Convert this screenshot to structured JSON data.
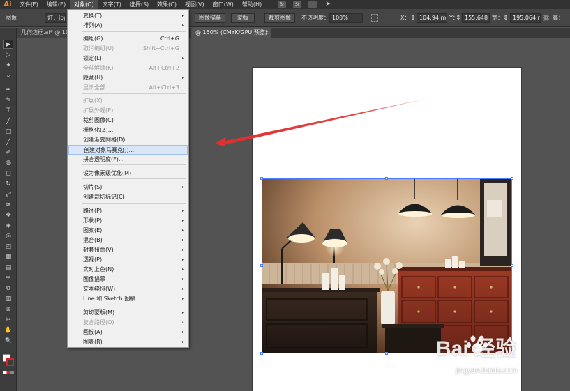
{
  "app": {
    "logo": "Ai"
  },
  "menubar": {
    "items": [
      "文件(F)",
      "编辑(E)",
      "对象(O)",
      "文字(T)",
      "选择(S)",
      "效果(C)",
      "视图(V)",
      "窗口(W)",
      "帮助(H)"
    ],
    "icons": [
      "Br",
      "St"
    ]
  },
  "controlbar": {
    "selection_type": "图像",
    "filename": "灯．jpg",
    "resolution_label": "PPI: 72",
    "trace_button": "图像描摹",
    "mask_button": "蒙版",
    "crop_button": "裁剪图像",
    "opacity_label": "不透明度：",
    "opacity_value": "100%",
    "x_label": "X：",
    "x_value": "104.94 mm",
    "y_label": "Y：",
    "y_value": "155.648 m",
    "w_label": "宽：",
    "w_value": "195.064 m",
    "h_label": "高："
  },
  "tabs": {
    "tab1": "几何边框.ai* @ 10",
    "tab2": "@ 150% (CMYK/GPU 预览)",
    "close": "×"
  },
  "tools": [
    "▶",
    "▷",
    "✦",
    "⌕",
    "✒",
    "✎",
    "T",
    "╱",
    "□",
    "╱",
    "✐",
    "◍",
    "◻",
    "↻",
    "⤢",
    "≋",
    "✥",
    "◈",
    "◎",
    "◰",
    "▦",
    "▤",
    "✑",
    "⧉",
    "▥",
    "⧈",
    "✂",
    "✋",
    "🔍"
  ],
  "object_menu": {
    "items": [
      {
        "label": "变换(T)",
        "shortcut": "",
        "submenu": true,
        "disabled": false
      },
      {
        "label": "排列(A)",
        "shortcut": "",
        "submenu": true,
        "disabled": false
      },
      {
        "label": "编组(G)",
        "shortcut": "Ctrl+G",
        "submenu": false,
        "disabled": false
      },
      {
        "label": "取消编组(U)",
        "shortcut": "Shift+Ctrl+G",
        "submenu": false,
        "disabled": true
      },
      {
        "label": "锁定(L)",
        "shortcut": "",
        "submenu": true,
        "disabled": false
      },
      {
        "label": "全部解锁(K)",
        "shortcut": "Alt+Ctrl+2",
        "submenu": false,
        "disabled": true
      },
      {
        "label": "隐藏(H)",
        "shortcut": "",
        "submenu": true,
        "disabled": false
      },
      {
        "label": "显示全部",
        "shortcut": "Alt+Ctrl+3",
        "submenu": false,
        "disabled": true
      },
      {
        "label": "扩展(X)...",
        "shortcut": "",
        "submenu": false,
        "disabled": true
      },
      {
        "label": "扩展外观(E)",
        "shortcut": "",
        "submenu": false,
        "disabled": true
      },
      {
        "label": "裁剪图像(C)",
        "shortcut": "",
        "submenu": false,
        "disabled": false
      },
      {
        "label": "栅格化(Z)...",
        "shortcut": "",
        "submenu": false,
        "disabled": false
      },
      {
        "label": "创建渐变网格(D)...",
        "shortcut": "",
        "submenu": false,
        "disabled": false
      },
      {
        "label": "创建对象马赛克(J)...",
        "shortcut": "",
        "submenu": false,
        "disabled": false,
        "highlight": true
      },
      {
        "label": "拼合透明度(F)...",
        "shortcut": "",
        "submenu": false,
        "disabled": false
      },
      {
        "label": "设为像素级优化(M)",
        "shortcut": "",
        "submenu": false,
        "disabled": false
      },
      {
        "label": "切片(S)",
        "shortcut": "",
        "submenu": true,
        "disabled": false
      },
      {
        "label": "创建裁切标记(C)",
        "shortcut": "",
        "submenu": false,
        "disabled": false
      },
      {
        "label": "路径(P)",
        "shortcut": "",
        "submenu": true,
        "disabled": false
      },
      {
        "label": "形状(P)",
        "shortcut": "",
        "submenu": true,
        "disabled": false
      },
      {
        "label": "图案(E)",
        "shortcut": "",
        "submenu": true,
        "disabled": false
      },
      {
        "label": "混合(B)",
        "shortcut": "",
        "submenu": true,
        "disabled": false
      },
      {
        "label": "封套扭曲(V)",
        "shortcut": "",
        "submenu": true,
        "disabled": false
      },
      {
        "label": "透视(P)",
        "shortcut": "",
        "submenu": true,
        "disabled": false
      },
      {
        "label": "实时上色(N)",
        "shortcut": "",
        "submenu": true,
        "disabled": false
      },
      {
        "label": "图像描摹",
        "shortcut": "",
        "submenu": true,
        "disabled": false
      },
      {
        "label": "文本绕排(W)",
        "shortcut": "",
        "submenu": true,
        "disabled": false
      },
      {
        "label": "Line 和 Sketch 图稿",
        "shortcut": "",
        "submenu": true,
        "disabled": false
      },
      {
        "label": "剪切蒙版(M)",
        "shortcut": "",
        "submenu": true,
        "disabled": false
      },
      {
        "label": "复合路径(O)",
        "shortcut": "",
        "submenu": true,
        "disabled": true
      },
      {
        "label": "画板(A)",
        "shortcut": "",
        "submenu": true,
        "disabled": false
      },
      {
        "label": "图表(R)",
        "shortcut": "",
        "submenu": true,
        "disabled": false
      }
    ],
    "submenu_arrow": "▸"
  },
  "watermark": {
    "logo": "Bai  经验",
    "url": "jingyan.baidu.com"
  },
  "colors": {
    "menu_bg": "#f0f0f0",
    "highlight": "#d8e6f7",
    "selection": "#4a7cff",
    "arrow": "#e03030",
    "app_accent": "#f7931e"
  }
}
